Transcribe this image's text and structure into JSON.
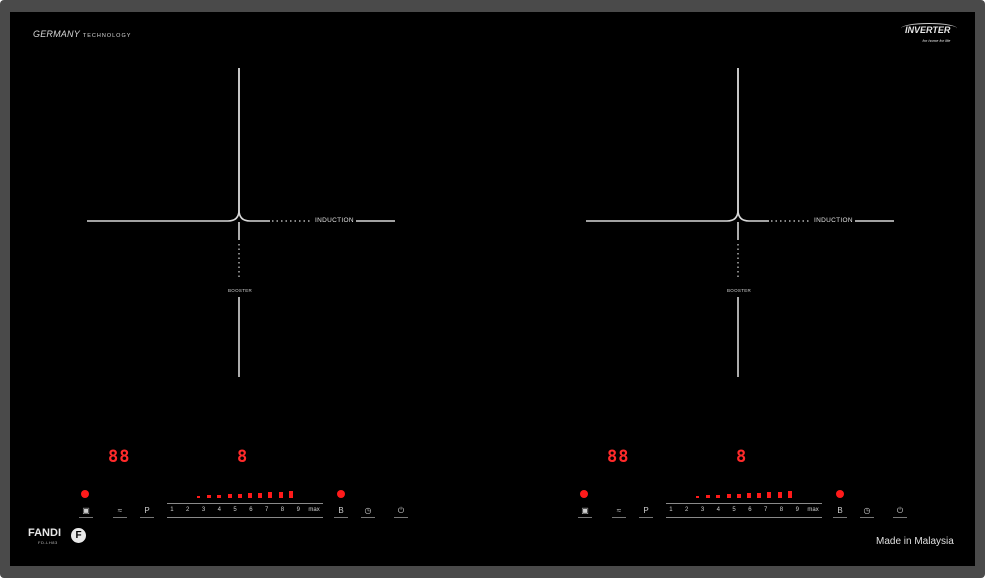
{
  "brand": {
    "tagline_main": "GERMANY",
    "tagline_sub": "TECHNOLOGY",
    "inverter_title": "INVERTER",
    "inverter_tag": "for home for life",
    "maker": "FANDI",
    "maker_logo": "F",
    "model": "FD-LH83",
    "origin": "Made in Malaysia"
  },
  "zones": [
    {
      "label": "INDUCTION",
      "booster_label": "BOOSTER",
      "timer_display": "88",
      "power_display": "8",
      "power_scale": [
        "1",
        "2",
        "3",
        "4",
        "5",
        "6",
        "7",
        "8",
        "9",
        "max"
      ],
      "power_level": 1.0,
      "controls": {
        "lock_icon": "lock-icon",
        "keep_warm_icon": "keep-warm-icon",
        "pause_label": "P",
        "booster_label": "B",
        "timer_icon": "clock-icon",
        "power_icon": "power-icon"
      }
    },
    {
      "label": "INDUCTION",
      "booster_label": "BOOSTER",
      "timer_display": "88",
      "power_display": "8",
      "power_scale": [
        "1",
        "2",
        "3",
        "4",
        "5",
        "6",
        "7",
        "8",
        "9",
        "max"
      ],
      "power_level": 1.0,
      "controls": {
        "lock_icon": "lock-icon",
        "keep_warm_icon": "keep-warm-icon",
        "pause_label": "P",
        "booster_label": "B",
        "timer_icon": "clock-icon",
        "power_icon": "power-icon"
      }
    }
  ],
  "colors": {
    "glass": "#000000",
    "frame": "#4a4a4a",
    "indicator": "#ff1a1a",
    "print": "#e0e0e0"
  }
}
